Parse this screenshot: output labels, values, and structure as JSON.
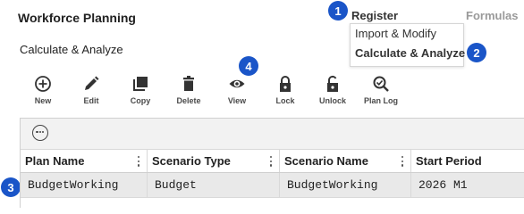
{
  "app": {
    "title": "Workforce Planning"
  },
  "page": {
    "subtitle": "Calculate & Analyze"
  },
  "top_nav": {
    "register": "Register",
    "formulas": "Formulas"
  },
  "dropdown": {
    "items": [
      "Import & Modify",
      "Calculate & Analyze"
    ]
  },
  "callouts": [
    "1",
    "2",
    "3",
    "4"
  ],
  "toolbar": {
    "items": [
      {
        "label": "New",
        "icon": "plus-circle-icon"
      },
      {
        "label": "Edit",
        "icon": "pencil-icon"
      },
      {
        "label": "Copy",
        "icon": "copy-icon"
      },
      {
        "label": "Delete",
        "icon": "trash-icon"
      },
      {
        "label": "View",
        "icon": "eye-icon"
      },
      {
        "label": "Lock",
        "icon": "lock-icon"
      },
      {
        "label": "Unlock",
        "icon": "unlock-icon"
      },
      {
        "label": "Plan Log",
        "icon": "search-log-icon"
      }
    ]
  },
  "grid": {
    "toolbar_icon": "more-horizontal-circle-icon",
    "columns": [
      "Plan Name",
      "Scenario Type",
      "Scenario Name",
      "Start Period"
    ],
    "rows": [
      [
        "BudgetWorking",
        "Budget",
        "BudgetWorking",
        "2026 M1"
      ]
    ]
  }
}
